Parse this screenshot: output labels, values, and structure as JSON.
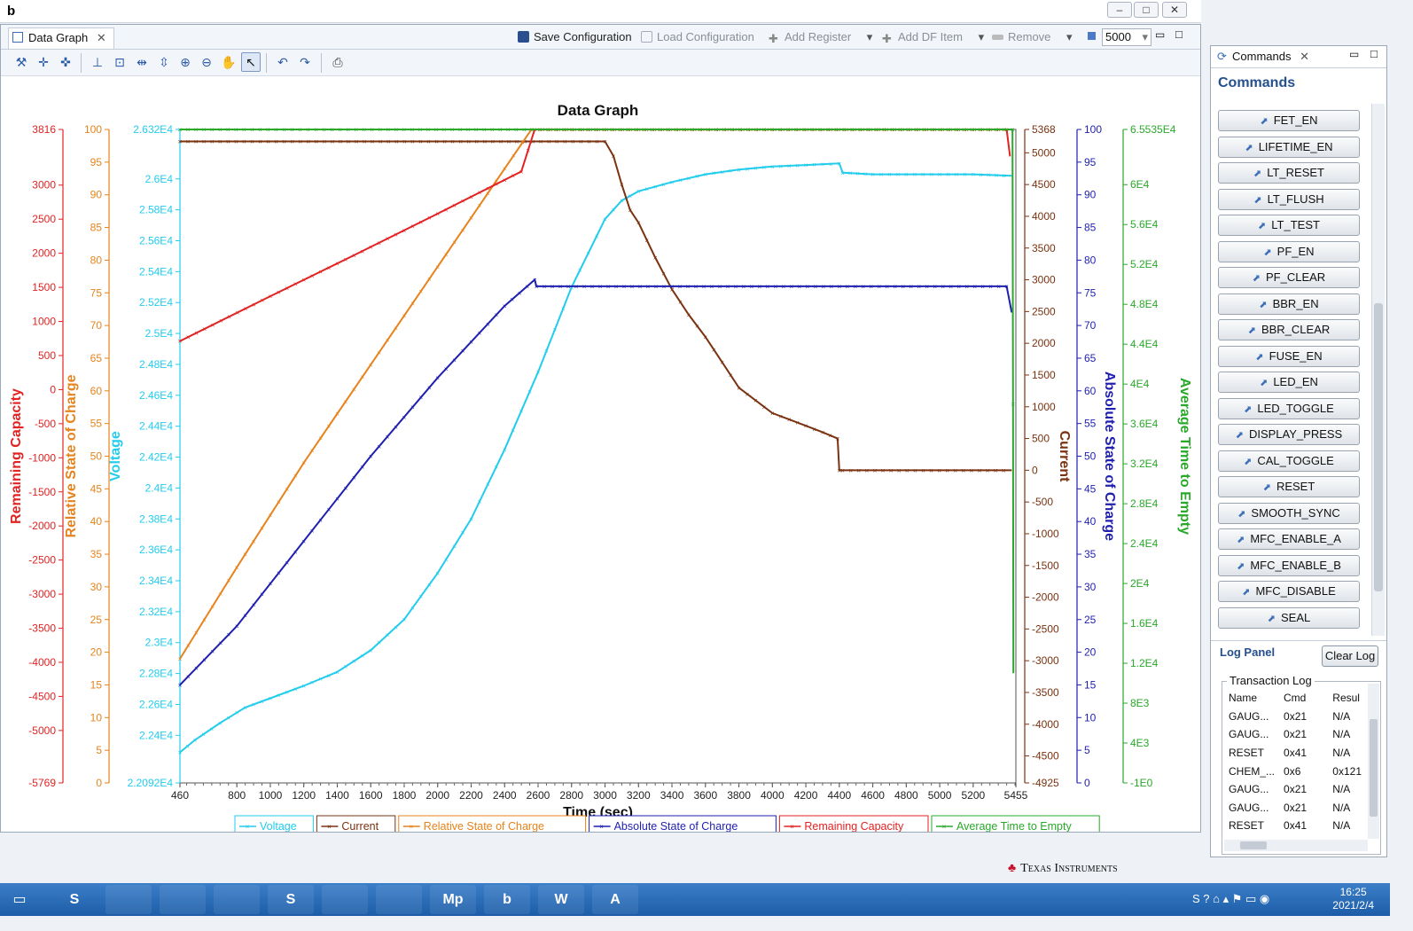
{
  "window": {
    "app_icon": "b"
  },
  "graph_tab": {
    "label": "Data Graph"
  },
  "graph_toolbar": {
    "save_label": "Save Configuration",
    "load_label": "Load Configuration",
    "add_register_label": "Add Register",
    "add_df_label": "Add DF Item",
    "remove_label": "Remove",
    "points_value": "5000"
  },
  "chart_data": {
    "type": "line",
    "title": "Data Graph",
    "xlabel": "Time (sec)",
    "xlim": [
      460,
      5455
    ],
    "x_ticks": [
      "460",
      "800",
      "1000",
      "1200",
      "1400",
      "1600",
      "1800",
      "2000",
      "2200",
      "2400",
      "2600",
      "2800",
      "3000",
      "3200",
      "3400",
      "3600",
      "3800",
      "4000",
      "4200",
      "4400",
      "4600",
      "4800",
      "5000",
      "5200",
      "5455"
    ],
    "axes": [
      {
        "name": "Remaining Capacity",
        "side": "left",
        "color": "#e32222",
        "min": -5769,
        "max": 3816,
        "ticks": [
          "3816",
          "3000",
          "2500",
          "2000",
          "1500",
          "1000",
          "500",
          "0",
          "-500",
          "-1000",
          "-1500",
          "-2000",
          "-2500",
          "-3000",
          "-3500",
          "-4000",
          "-4500",
          "-5000",
          "-5769"
        ]
      },
      {
        "name": "Relative State of Charge",
        "side": "left",
        "color": "#e6831c",
        "min": 0,
        "max": 100,
        "ticks": [
          "100",
          "95",
          "90",
          "85",
          "80",
          "75",
          "70",
          "65",
          "60",
          "55",
          "50",
          "45",
          "40",
          "35",
          "30",
          "25",
          "20",
          "15",
          "10",
          "5",
          "0"
        ]
      },
      {
        "name": "Voltage",
        "side": "left",
        "color": "#22ccec",
        "min": 22092,
        "max": 26320,
        "ticks": [
          "2.632E4",
          "2.6E4",
          "2.58E4",
          "2.56E4",
          "2.54E4",
          "2.52E4",
          "2.5E4",
          "2.48E4",
          "2.46E4",
          "2.44E4",
          "2.42E4",
          "2.4E4",
          "2.38E4",
          "2.36E4",
          "2.34E4",
          "2.32E4",
          "2.3E4",
          "2.28E4",
          "2.26E4",
          "2.24E4",
          "2.2092E4"
        ]
      },
      {
        "name": "Current",
        "side": "right",
        "color": "#7a3210",
        "min": -4925,
        "max": 5368,
        "ticks": [
          "5368",
          "5000",
          "4500",
          "4000",
          "3500",
          "3000",
          "2500",
          "2000",
          "1500",
          "1000",
          "500",
          "0",
          "-500",
          "-1000",
          "-1500",
          "-2000",
          "-2500",
          "-3000",
          "-3500",
          "-4000",
          "-4500",
          "-4925"
        ]
      },
      {
        "name": "Absolute State of Charge",
        "side": "right",
        "color": "#1f1fb0",
        "min": 0,
        "max": 100,
        "ticks": [
          "100",
          "95",
          "90",
          "85",
          "80",
          "75",
          "70",
          "65",
          "60",
          "55",
          "50",
          "45",
          "40",
          "35",
          "30",
          "25",
          "20",
          "15",
          "10",
          "5",
          "0"
        ]
      },
      {
        "name": "Average Time to Empty",
        "side": "right",
        "color": "#2aa82a",
        "min": -1,
        "max": 65535,
        "ticks": [
          "6.5535E4",
          "6E4",
          "5.6E4",
          "5.2E4",
          "4.8E4",
          "4.4E4",
          "4E4",
          "3.6E4",
          "3.2E4",
          "2.8E4",
          "2.4E4",
          "2E4",
          "1.6E4",
          "1.2E4",
          "8E3",
          "4E3",
          "-1E0"
        ]
      }
    ],
    "series": [
      {
        "name": "Voltage",
        "axis": 2,
        "color": "#22ccec",
        "x": [
          460,
          550,
          700,
          850,
          1000,
          1200,
          1400,
          1600,
          1800,
          2000,
          2200,
          2400,
          2600,
          2800,
          3000,
          3100,
          3200,
          3400,
          3600,
          3800,
          4000,
          4200,
          4400,
          4420,
          4600,
          4800,
          5000,
          5200,
          5430
        ],
        "y": [
          22290,
          22370,
          22480,
          22580,
          22640,
          22720,
          22810,
          22950,
          23150,
          23450,
          23800,
          24250,
          24750,
          25300,
          25740,
          25860,
          25920,
          25980,
          26030,
          26060,
          26080,
          26090,
          26100,
          26040,
          26030,
          26030,
          26030,
          26030,
          26020
        ]
      },
      {
        "name": "Current",
        "axis": 3,
        "color": "#7a3210",
        "x": [
          460,
          3000,
          3050,
          3100,
          3150,
          3200,
          3300,
          3400,
          3500,
          3600,
          3700,
          3800,
          3900,
          4000,
          4200,
          4300,
          4390,
          4400,
          4420,
          5430
        ],
        "y": [
          5180,
          5180,
          4950,
          4500,
          4100,
          3900,
          3350,
          2850,
          2450,
          2100,
          1700,
          1300,
          1100,
          900,
          700,
          600,
          500,
          0,
          0,
          0
        ]
      },
      {
        "name": "Relative State of Charge",
        "axis": 1,
        "color": "#e6831c",
        "x": [
          460,
          800,
          1200,
          1600,
          2000,
          2400,
          2560,
          5430
        ],
        "y": [
          19,
          33,
          49,
          64,
          79,
          94,
          100,
          100
        ]
      },
      {
        "name": "Absolute State of Charge",
        "axis": 4,
        "color": "#1f1fb0",
        "x": [
          460,
          800,
          1200,
          1600,
          2000,
          2400,
          2580,
          2590,
          5400,
          5430
        ],
        "y": [
          15,
          24,
          37,
          50,
          62,
          73,
          77,
          76,
          76,
          72
        ]
      },
      {
        "name": "Remaining Capacity",
        "axis": 0,
        "color": "#e32222",
        "x": [
          460,
          1000,
          1500,
          2000,
          2500,
          2580,
          5400,
          5420
        ],
        "y": [
          711,
          1370,
          1970,
          2580,
          3200,
          3816,
          3816,
          3420
        ]
      },
      {
        "name": "Average Time to Empty",
        "axis": 5,
        "color": "#2aa82a",
        "x": [
          460,
          5435,
          5438,
          5440
        ],
        "y": [
          65535,
          65535,
          38000,
          11000
        ]
      }
    ],
    "legend_position": "bottom"
  },
  "commands": {
    "tab_label": "Commands",
    "heading": "Commands",
    "buttons": [
      "FET_EN",
      "LIFETIME_EN",
      "LT_RESET",
      "LT_FLUSH",
      "LT_TEST",
      "PF_EN",
      "PF_CLEAR",
      "BBR_EN",
      "BBR_CLEAR",
      "FUSE_EN",
      "LED_EN",
      "LED_TOGGLE",
      "DISPLAY_PRESS",
      "CAL_TOGGLE",
      "RESET",
      "SMOOTH_SYNC",
      "MFC_ENABLE_A",
      "MFC_ENABLE_B",
      "MFC_DISABLE",
      "SEAL"
    ]
  },
  "log": {
    "title": "Log Panel",
    "clear_label": "Clear Log",
    "transaction_label": "Transaction Log",
    "columns": [
      "Name",
      "Cmd",
      "Resul"
    ],
    "rows": [
      [
        "GAUG...",
        "0x21",
        "N/A"
      ],
      [
        "GAUG...",
        "0x21",
        "N/A"
      ],
      [
        "RESET",
        "0x41",
        "N/A"
      ],
      [
        "CHEM_...",
        "0x6",
        "0x121"
      ],
      [
        "GAUG...",
        "0x21",
        "N/A"
      ],
      [
        "GAUG...",
        "0x21",
        "N/A"
      ],
      [
        "RESET",
        "0x41",
        "N/A"
      ]
    ]
  },
  "footer": {
    "brand": "Texas Instruments"
  },
  "taskbar": {
    "apps": [
      "S",
      "",
      "",
      "",
      "S",
      "",
      "",
      "Mp",
      "b",
      "W",
      "A"
    ],
    "time": "16:25",
    "date": "2021/2/4"
  }
}
